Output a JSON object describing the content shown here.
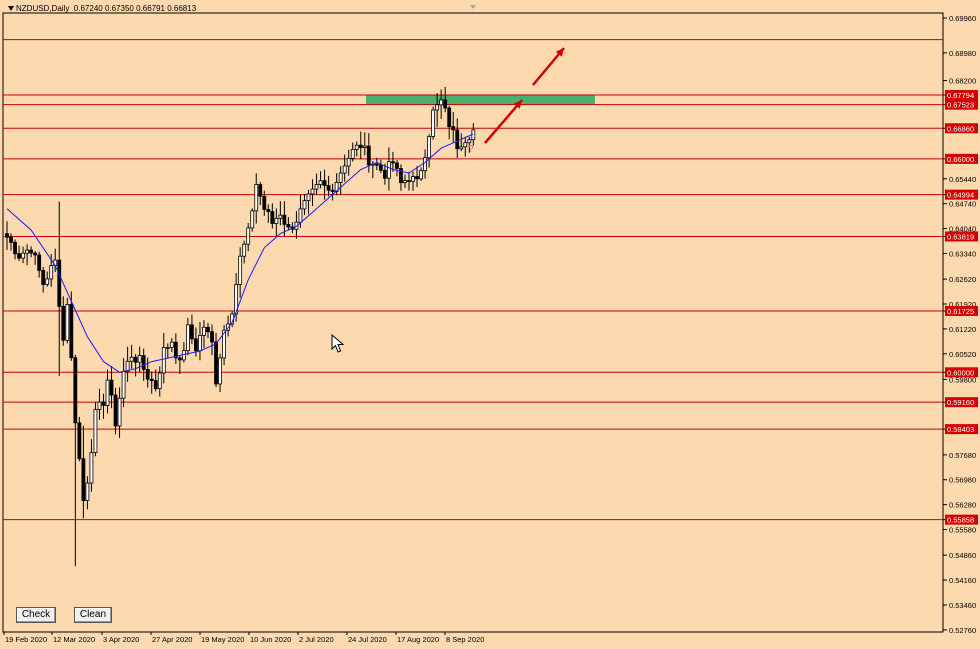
{
  "chart_data": {
    "type": "candlestick",
    "title": "NZDUSD,Daily",
    "ohlc_header": "0.67240 0.67350 0.66791 0.66813",
    "ylim": [
      0.527,
      0.701
    ],
    "y_ticks": [
      "0.69960",
      "0.68980",
      "0.68200",
      "0.67794",
      "0.67523",
      "0.66860",
      "0.66000",
      "0.65440",
      "0.64994",
      "0.64740",
      "0.64040",
      "0.63819",
      "0.63340",
      "0.62620",
      "0.61920",
      "0.61725",
      "0.61220",
      "0.60520",
      "0.60000",
      "0.59800",
      "0.59160",
      "0.58403",
      "0.57680",
      "0.56980",
      "0.56280",
      "0.55858",
      "0.55580",
      "0.54860",
      "0.54160",
      "0.53460",
      "0.52760"
    ],
    "x_labels": [
      "19 Feb 2020",
      "12 Mar 2020",
      "3 Apr 2020",
      "27 Apr 2020",
      "19 May 2020",
      "10 Jun 2020",
      "2 Jul 2020",
      "24 Jul 2020",
      "17 Aug 2020",
      "8 Sep 2020"
    ],
    "horizontal_levels": [
      0.6935,
      0.67794,
      0.67523,
      0.6686,
      0.66,
      0.64994,
      0.63819,
      0.61725,
      0.6,
      0.5916,
      0.58403,
      0.55858
    ],
    "resistance_zone": {
      "from": 0.67523,
      "to": 0.67794,
      "color": "#4caf6e"
    },
    "moving_average_color": "#1a1aff",
    "level_color": "#c80000",
    "label_bg": "#d40000",
    "annotation_text": "?",
    "close_path": [
      [
        0,
        0.638
      ],
      [
        3,
        0.633
      ],
      [
        6,
        0.635
      ],
      [
        9,
        0.625
      ],
      [
        12,
        0.631
      ],
      [
        14,
        0.609
      ],
      [
        15,
        0.62
      ],
      [
        17,
        0.587
      ],
      [
        19,
        0.564
      ],
      [
        20,
        0.57
      ],
      [
        22,
        0.588
      ],
      [
        24,
        0.592
      ],
      [
        25,
        0.598
      ],
      [
        27,
        0.586
      ],
      [
        29,
        0.6
      ],
      [
        31,
        0.605
      ],
      [
        33,
        0.603
      ],
      [
        35,
        0.599
      ],
      [
        37,
        0.596
      ],
      [
        39,
        0.606
      ],
      [
        41,
        0.609
      ],
      [
        43,
        0.602
      ],
      [
        45,
        0.612
      ],
      [
        47,
        0.607
      ],
      [
        49,
        0.613
      ],
      [
        51,
        0.608
      ],
      [
        52,
        0.598
      ],
      [
        54,
        0.612
      ],
      [
        56,
        0.618
      ],
      [
        58,
        0.632
      ],
      [
        60,
        0.639
      ],
      [
        62,
        0.653
      ],
      [
        64,
        0.646
      ],
      [
        66,
        0.642
      ],
      [
        68,
        0.645
      ],
      [
        70,
        0.64
      ],
      [
        72,
        0.643
      ],
      [
        74,
        0.647
      ],
      [
        76,
        0.65
      ],
      [
        78,
        0.653
      ],
      [
        80,
        0.651
      ],
      [
        82,
        0.654
      ],
      [
        84,
        0.659
      ],
      [
        86,
        0.662
      ],
      [
        88,
        0.664
      ],
      [
        90,
        0.66
      ],
      [
        92,
        0.658
      ],
      [
        94,
        0.656
      ],
      [
        96,
        0.659
      ],
      [
        98,
        0.653
      ],
      [
        100,
        0.655
      ],
      [
        102,
        0.653
      ],
      [
        104,
        0.662
      ],
      [
        106,
        0.673
      ],
      [
        108,
        0.676
      ],
      [
        110,
        0.67
      ],
      [
        112,
        0.664
      ],
      [
        114,
        0.666
      ],
      [
        116,
        0.6681
      ]
    ],
    "ma_path": [
      [
        0,
        0.646
      ],
      [
        6,
        0.64
      ],
      [
        12,
        0.63
      ],
      [
        16,
        0.62
      ],
      [
        20,
        0.61
      ],
      [
        24,
        0.603
      ],
      [
        28,
        0.6
      ],
      [
        32,
        0.601
      ],
      [
        36,
        0.603
      ],
      [
        40,
        0.604
      ],
      [
        44,
        0.605
      ],
      [
        48,
        0.606
      ],
      [
        52,
        0.608
      ],
      [
        56,
        0.614
      ],
      [
        60,
        0.626
      ],
      [
        64,
        0.635
      ],
      [
        68,
        0.639
      ],
      [
        72,
        0.641
      ],
      [
        76,
        0.645
      ],
      [
        80,
        0.649
      ],
      [
        84,
        0.653
      ],
      [
        88,
        0.657
      ],
      [
        92,
        0.659
      ],
      [
        96,
        0.657
      ],
      [
        100,
        0.656
      ],
      [
        104,
        0.659
      ],
      [
        108,
        0.663
      ],
      [
        112,
        0.665
      ],
      [
        116,
        0.667
      ]
    ],
    "spikes": [
      {
        "i": 17,
        "low": 0.5455,
        "high": 0.592
      },
      {
        "i": 19,
        "low": 0.559,
        "high": 0.585
      },
      {
        "i": 13,
        "low": 0.599,
        "high": 0.648
      },
      {
        "i": 107,
        "low": 0.669,
        "high": 0.6785
      }
    ]
  },
  "buttons": {
    "check": "Check",
    "clean": "Clean"
  }
}
